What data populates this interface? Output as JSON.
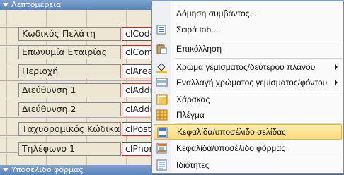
{
  "form": {
    "detail_section": "Λεπτομέρεια",
    "footer_section": "Υποσέλιδο φόρμας",
    "fields": [
      {
        "label": "Κωδικός Πελάτη",
        "control": "clCode"
      },
      {
        "label": "Επωνυμία Εταιρίας",
        "control": "clCom"
      },
      {
        "label": "Περιοχή",
        "control": "clArea"
      },
      {
        "label": "Διεύθυνση 1",
        "control": "clAddr"
      },
      {
        "label": "Διεύθυνση 2",
        "control": "clAddr"
      },
      {
        "label": "Ταχυδρομικός Κώδικας",
        "control": "clPost"
      },
      {
        "label": "Τηλέφωνο 1",
        "control": "clPhon"
      }
    ]
  },
  "menu": {
    "items": [
      {
        "label": "Δόμηση συμβάντος...",
        "icon": "blank"
      },
      {
        "label": "Σειρά tab...",
        "icon": "tab-order-icon"
      },
      {
        "label": "Επικόλληση",
        "icon": "paste-icon"
      },
      {
        "label": "Χρώμα γεμίσματος/δεύτερου πλάνου",
        "icon": "fill-color-icon",
        "submenu": true
      },
      {
        "label": "Εναλλαγή χρώματος γεμίσματος/φόντου",
        "icon": "alternate-fill-icon",
        "submenu": true
      },
      {
        "label": "Χάρακας",
        "icon": "ruler-icon"
      },
      {
        "label": "Πλέγμα",
        "icon": "grid-icon"
      },
      {
        "label": "Κεφαλίδα/υποσέλιδο σελίδας",
        "icon": "page-header-footer-icon",
        "highlighted": true
      },
      {
        "label": "Κεφαλίδα/υποσέλιδο φόρμας",
        "icon": "form-header-footer-icon"
      },
      {
        "label": "Ιδιότητες",
        "icon": "properties-icon"
      }
    ]
  },
  "colors": {
    "highlight": "#fbd978",
    "section_bar": "#5a83ba"
  }
}
